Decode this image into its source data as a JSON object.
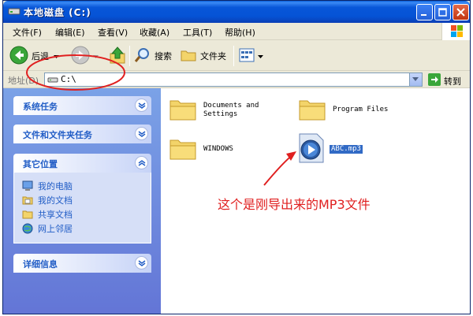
{
  "window": {
    "title": "本地磁盘 (C:)"
  },
  "menu": {
    "items": [
      "文件(F)",
      "编辑(E)",
      "查看(V)",
      "收藏(A)",
      "工具(T)",
      "帮助(H)"
    ]
  },
  "toolbar": {
    "back_label": "后退",
    "search_label": "搜索",
    "folders_label": "文件夹"
  },
  "address": {
    "label": "地址(D)",
    "value": "C:\\",
    "go_label": "转到"
  },
  "left_pane": {
    "system_tasks": "系统任务",
    "file_folder_tasks": "文件和文件夹任务",
    "other_places": {
      "title": "其它位置",
      "items": [
        "我的电脑",
        "我的文档",
        "共享文档",
        "网上邻居"
      ]
    },
    "details": "详细信息"
  },
  "files": [
    {
      "name_line1": "Documents and",
      "name_line2": "Settings",
      "type": "folder"
    },
    {
      "name_line1": "Program Files",
      "name_line2": "",
      "type": "folder"
    },
    {
      "name_line1": "WINDOWS",
      "name_line2": "",
      "type": "folder"
    },
    {
      "name_line1": "ABC.mp3",
      "name_line2": "",
      "type": "mp3"
    }
  ],
  "annotation": {
    "text": "这个是刚导出来的MP3文件"
  },
  "colors": {
    "title_blue": "#0553d6",
    "task_pane_blue": "#6375d6",
    "annotation_red": "#e02020",
    "selection_blue": "#316ac5"
  }
}
